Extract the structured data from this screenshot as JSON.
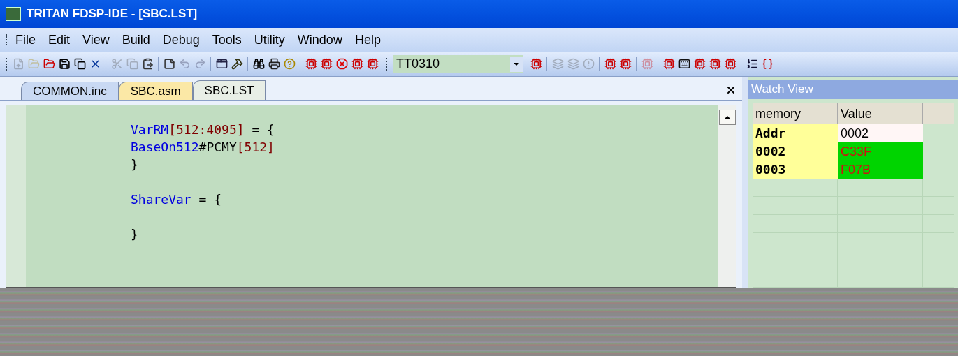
{
  "window": {
    "title": "TRITAN FDSP-IDE  - [SBC.LST]"
  },
  "menu": [
    "File",
    "Edit",
    "View",
    "Build",
    "Debug",
    "Tools",
    "Utility",
    "Window",
    "Help"
  ],
  "toolbar": [
    [
      {
        "kind": "new",
        "disabled": true
      },
      {
        "kind": "open",
        "disabled": true
      },
      {
        "kind": "open-file",
        "disabled": false
      },
      {
        "kind": "save",
        "disabled": false
      },
      {
        "kind": "save-all",
        "disabled": false
      },
      {
        "kind": "close",
        "disabled": false
      }
    ],
    [
      {
        "kind": "cut",
        "disabled": true
      },
      {
        "kind": "copy",
        "disabled": true
      },
      {
        "kind": "paste",
        "disabled": false
      }
    ],
    [
      {
        "kind": "note",
        "disabled": false
      },
      {
        "kind": "undo",
        "disabled": true
      },
      {
        "kind": "redo",
        "disabled": true
      }
    ],
    [
      {
        "kind": "window",
        "disabled": false
      },
      {
        "kind": "tool",
        "disabled": false
      }
    ],
    [
      {
        "kind": "find",
        "disabled": false
      },
      {
        "kind": "print",
        "disabled": false
      },
      {
        "kind": "help",
        "disabled": false
      }
    ],
    [
      {
        "kind": "chip",
        "disabled": false
      },
      {
        "kind": "chip",
        "disabled": false
      },
      {
        "kind": "stop",
        "disabled": false
      },
      {
        "kind": "chip",
        "disabled": false
      },
      {
        "kind": "chip",
        "disabled": false
      }
    ]
  ],
  "project_select": {
    "value": "TT0310"
  },
  "toolbar2": [
    [
      {
        "kind": "chip",
        "disabled": false
      }
    ],
    [
      {
        "kind": "stack",
        "disabled": true
      },
      {
        "kind": "stack",
        "disabled": true
      },
      {
        "kind": "alert",
        "disabled": true
      }
    ],
    [
      {
        "kind": "chip",
        "disabled": false
      },
      {
        "kind": "chip",
        "disabled": false
      }
    ],
    [
      {
        "kind": "chip",
        "disabled": true
      }
    ],
    [
      {
        "kind": "chip",
        "disabled": false
      },
      {
        "kind": "keyboard",
        "disabled": false
      },
      {
        "kind": "chip",
        "disabled": false
      },
      {
        "kind": "chip",
        "disabled": false
      },
      {
        "kind": "chip",
        "disabled": false
      }
    ],
    [
      {
        "kind": "list",
        "disabled": false
      },
      {
        "kind": "braces",
        "disabled": false
      }
    ]
  ],
  "tabs": [
    {
      "label": "COMMON.inc",
      "selected": false,
      "modified": false
    },
    {
      "label": "SBC.asm",
      "selected": false,
      "modified": true
    },
    {
      "label": "SBC.LST",
      "selected": true,
      "modified": false
    }
  ],
  "editor": {
    "lines": [
      {
        "kind": "code",
        "tokens": [
          {
            "kind": "ident",
            "text": "VarRM"
          },
          {
            "kind": "num",
            "text": "[512:4095]"
          },
          {
            "kind": "plain",
            "text": " = {"
          }
        ]
      },
      {
        "kind": "code",
        "tokens": [
          {
            "kind": "ident",
            "text": "BaseOn512"
          },
          {
            "kind": "plain",
            "text": "#PCMY"
          },
          {
            "kind": "num",
            "text": "[512]"
          }
        ]
      },
      {
        "kind": "code",
        "tokens": [
          {
            "kind": "plain",
            "text": "}"
          }
        ]
      },
      {
        "kind": "blank"
      },
      {
        "kind": "code",
        "tokens": [
          {
            "kind": "ident",
            "text": "ShareVar"
          },
          {
            "kind": "plain",
            "text": " = {"
          }
        ]
      },
      {
        "kind": "blank"
      },
      {
        "kind": "code",
        "tokens": [
          {
            "kind": "plain",
            "text": "}"
          }
        ]
      }
    ]
  },
  "watch": {
    "title": "Watch View",
    "columns": [
      "memory",
      "Value"
    ],
    "rows": [
      {
        "memory": "Addr",
        "value": "0002",
        "changed": false
      },
      {
        "memory": "0002",
        "value": "C33F",
        "changed": true
      },
      {
        "memory": "0003",
        "value": "F07B",
        "changed": true
      }
    ]
  }
}
